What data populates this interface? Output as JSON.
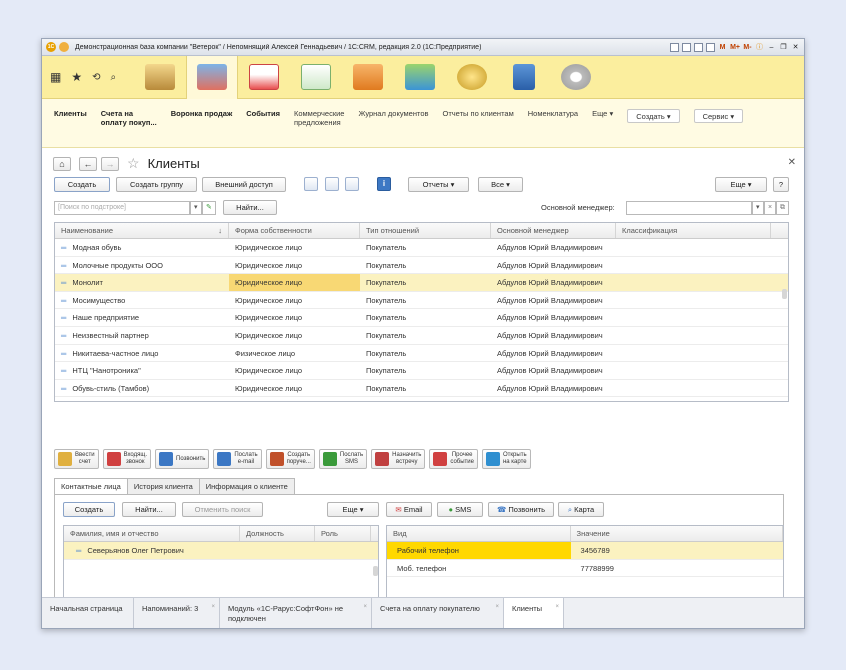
{
  "window": {
    "title": "Демонстрационная база компании \"Ветерок\" / Непомнящий Алексей Геннадьевич / 1С:CRM, редакция 2.0  (1С:Предприятие)",
    "tools": [
      "M",
      "M+",
      "M-"
    ]
  },
  "sections": [
    "apps-icon",
    "star-icon",
    "history-icon",
    "search-icon"
  ],
  "funcbar": {
    "items": [
      "Клиенты",
      "Счета на\nоплату покуп...",
      "Воронка продаж",
      "События",
      "Коммерческие\nпредложения",
      "Журнал документов",
      "Отчеты по клиентам",
      "Номенклатура"
    ],
    "more": "Еще",
    "create": "Создать",
    "service": "Сервис"
  },
  "form": {
    "title": "Клиенты",
    "buttons": {
      "create": "Создать",
      "create_group": "Создать группу",
      "external_access": "Внешний доступ",
      "reports": "Отчеты",
      "all": "Все",
      "more": "Еще",
      "help": "?"
    },
    "search_placeholder": "[Поиск по подстроке]",
    "find": "Найти...",
    "manager_label": "Основной менеджер:"
  },
  "grid": {
    "columns": [
      "Наименование",
      "Форма собственности",
      "Тип отношений",
      "Основной менеджер",
      "Классификация"
    ],
    "rows": [
      [
        "Модная обувь",
        "Юридическое лицо",
        "Покупатель",
        "Абдулов Юрий Владимирович",
        ""
      ],
      [
        "Молочные продукты ООО",
        "Юридическое лицо",
        "Покупатель",
        "Абдулов Юрий Владимирович",
        ""
      ],
      [
        "Монолит",
        "Юридическое лицо",
        "Покупатель",
        "Абдулов Юрий Владимирович",
        ""
      ],
      [
        "Мосимущество",
        "Юридическое лицо",
        "Покупатель",
        "Абдулов Юрий Владимирович",
        ""
      ],
      [
        "Наше предприятие",
        "Юридическое лицо",
        "Покупатель",
        "Абдулов Юрий Владимирович",
        ""
      ],
      [
        "Неизвестный партнер",
        "Юридическое лицо",
        "Покупатель",
        "Абдулов Юрий Владимирович",
        ""
      ],
      [
        "Никитаева-частное лицо",
        "Физическое лицо",
        "Покупатель",
        "Абдулов Юрий Владимирович",
        ""
      ],
      [
        "НТЦ \"Нанотроника\"",
        "Юридическое лицо",
        "Покупатель",
        "Абдулов Юрий Владимирович",
        ""
      ],
      [
        "Обувь-стиль (Тамбов)",
        "Юридическое лицо",
        "Покупатель",
        "Абдулов Юрий Владимирович",
        ""
      ]
    ],
    "selected_index": 2
  },
  "commands": [
    "Ввести\nсчет",
    "Входящ.\nзвонок",
    "Позвонить",
    "Послать\ne-mail",
    "Создать\nпоруче...",
    "Послать\nSMS",
    "Назначить\nвстречу",
    "Прочее\nсобытие",
    "Открыть\nна карте"
  ],
  "tabs": [
    "Контактные лица",
    "История клиента",
    "Информация о клиенте"
  ],
  "contacts": {
    "buttons": {
      "create": "Создать",
      "find": "Найти...",
      "cancel_search": "Отменить поиск",
      "more": "Еще",
      "email": "Email",
      "sms": "SMS",
      "call": "Позвонить",
      "map": "Карта"
    },
    "columns": [
      "Фамилия, имя и отчество",
      "Должность",
      "Роль"
    ],
    "rows": [
      [
        "Северьянов Олег  Петрович",
        "",
        ""
      ]
    ],
    "phone_columns": [
      "Вид",
      "Значение"
    ],
    "phones": [
      [
        "Рабочий телефон",
        "3456789"
      ],
      [
        "Моб. телефон",
        "77788999"
      ]
    ]
  },
  "bottom_tabs": [
    "Начальная страница",
    "Напоминаний: 3",
    "Модуль «1С-Рарус:СофтФон» не\nподключен",
    "Счета на оплату покупателю",
    "Клиенты"
  ]
}
